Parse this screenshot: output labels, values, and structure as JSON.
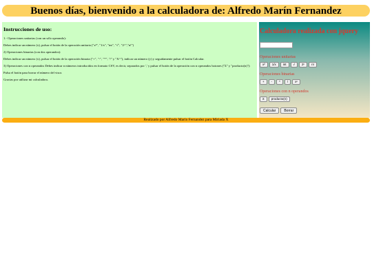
{
  "header": {
    "title": "Buenos días, bienvenido a la calculadora de: Alfredo Marín Fernandez"
  },
  "instructions": {
    "heading": "Instrucciones de uso:",
    "paragraphs": [
      "1.- Operaciones unitarias (con un sólo operando):",
      "Debes indicar un número (x), pulsar el botón de la operación unitaria (\"x²\", \"1/x\", \"int\", \"√\", \"2^\",\"n!\")",
      "2) Operaciones binarias (con dos operandos):",
      "Debes indicar un número (x), pulsar el botón de la operación binaria (\"+\", \"-\", \"*\", \"/\" y \"X^\"), indicar un número (y) y seguidamente pulsar el botón Calcular.",
      "3) Operaciones con n operandos Debes indicar n números introducidos en formato CSV, es decir, separados por ',' y pulsar el botón de la operación con n operandos botones (\"Σ\" y \"producto(n)\"):",
      "Pulsa el botón para borrar el número del visor.",
      "Gracias por utilizar mi calculadora."
    ]
  },
  "calculator": {
    "title": "Calculadora realizada con jquery",
    "display_value": "",
    "sections": {
      "unary": "Operaciones unitarias",
      "binary": "Operaciones binarias",
      "nary": "Operaciones con n operandos"
    },
    "unary_buttons": [
      "x²",
      "1/x",
      "int",
      "√",
      "2ⁿ",
      "n!"
    ],
    "binary_buttons": [
      "+",
      "-",
      "*",
      "/",
      "xⁿ"
    ],
    "nary_buttons": [
      "Σ",
      "producto(n)"
    ],
    "calculate_label": "Calcular",
    "clear_label": "Borrar"
  },
  "footer": {
    "text": "Realizado por Alfredo Marín Fernandez para Miriada X"
  },
  "colors": {
    "header_bg": "#fdd161",
    "instructions_bg": "#cdfec4",
    "footer_bg": "#fbae12",
    "accent_red": "#d53a2f",
    "calc_gradient_top": "#0c8a82",
    "calc_gradient_bottom": "#f5e6c4"
  }
}
